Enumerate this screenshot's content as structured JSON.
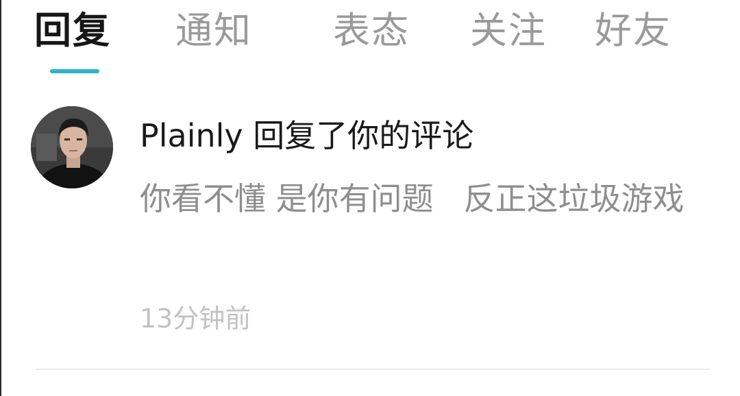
{
  "tabs": [
    {
      "label": "回复",
      "active": true
    },
    {
      "label": "通知",
      "active": false
    },
    {
      "label": "表态",
      "active": false
    },
    {
      "label": "关注",
      "active": false
    },
    {
      "label": "好友",
      "active": false
    }
  ],
  "accent_color": "#29b6c6",
  "notification": {
    "avatar_icon": "user-avatar",
    "title": "Plainly 回复了你的评论",
    "body": "你看不懂 是你有问题   反正这垃圾游戏",
    "time": "13分钟前"
  }
}
